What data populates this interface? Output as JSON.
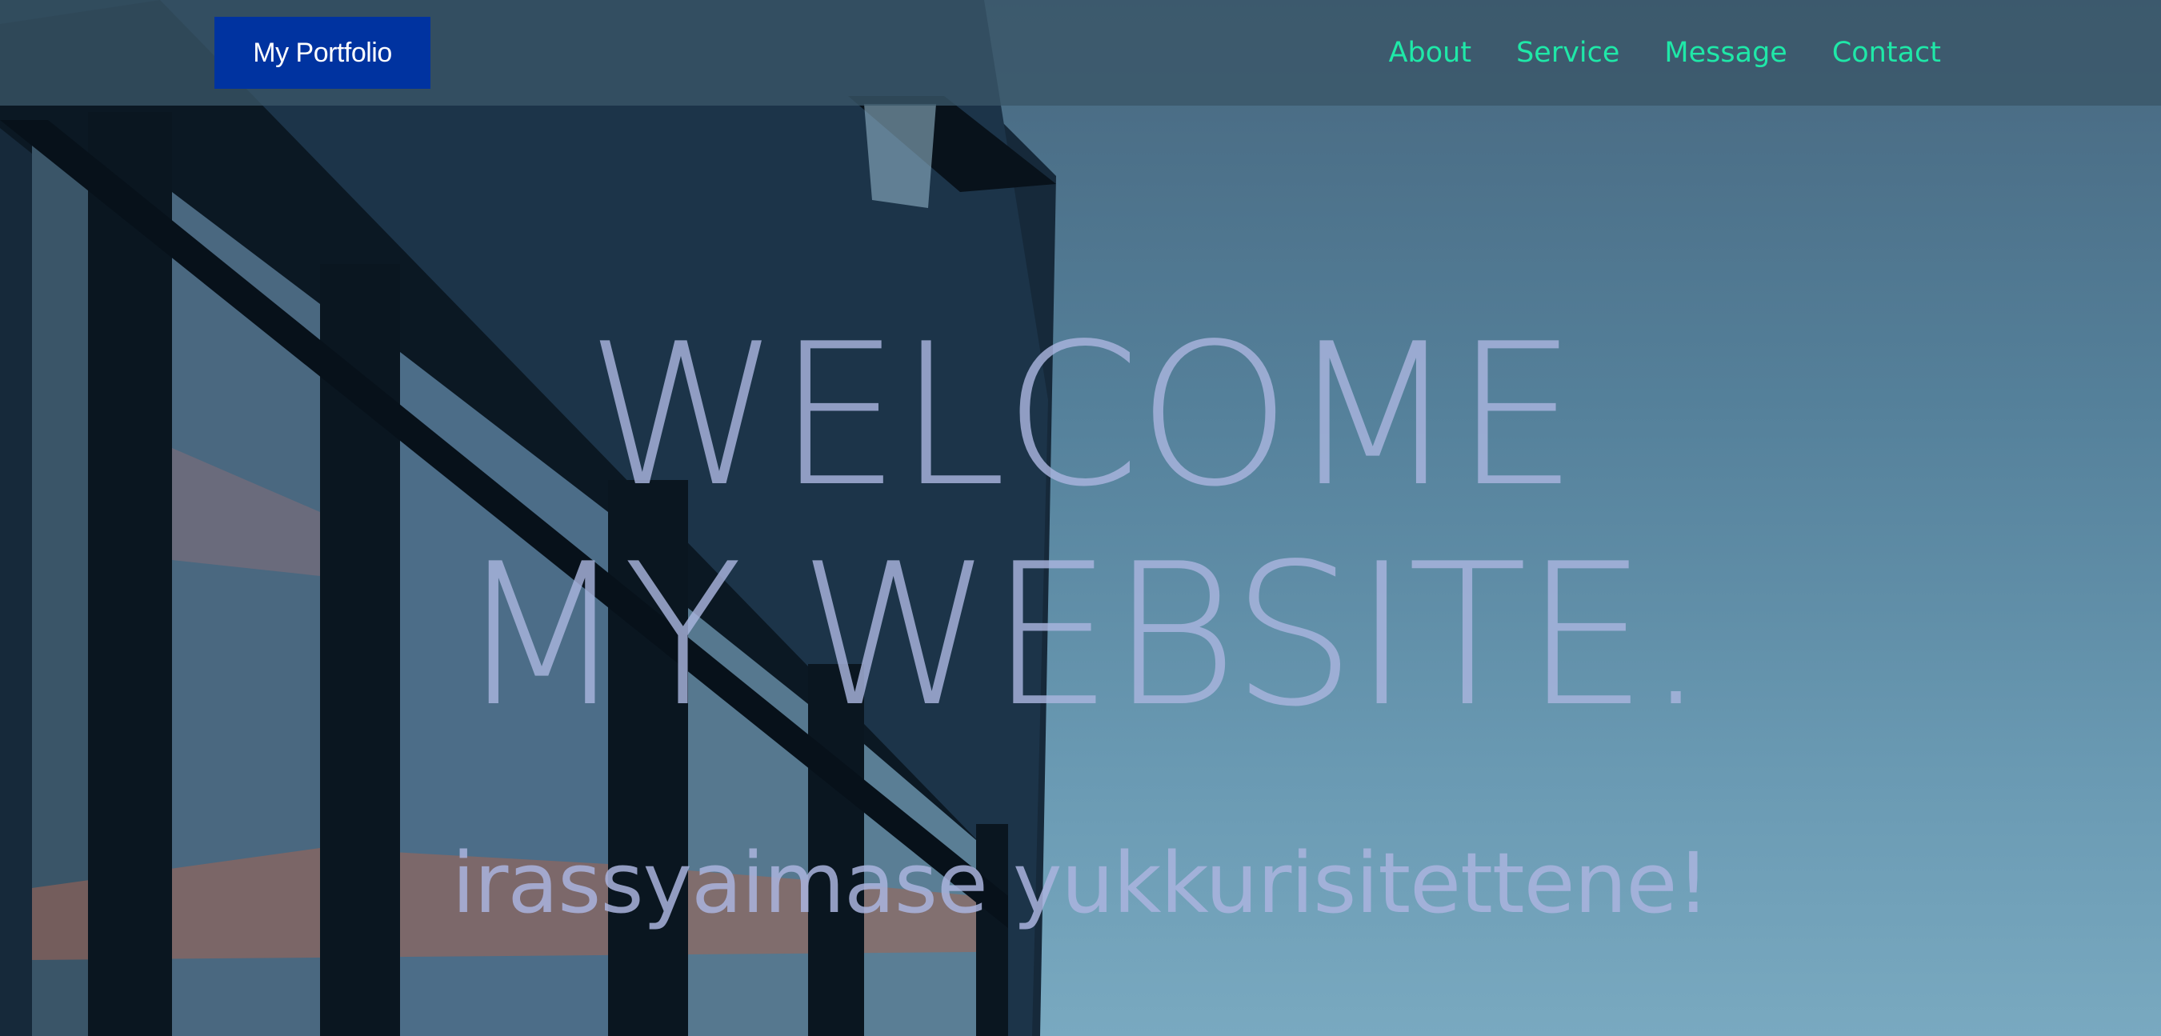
{
  "nav": {
    "brand": "My Portfolio",
    "links": [
      "About",
      "Service",
      "Message",
      "Contact"
    ]
  },
  "hero": {
    "line1": "WELCOME",
    "line2": "MY WEBSITE.",
    "subtitle": "irassyaimase yukkurisitettene!"
  },
  "colors": {
    "brand_bg": "#0033a0",
    "nav_link": "#1fe8a8",
    "headline": "#aab4de"
  }
}
